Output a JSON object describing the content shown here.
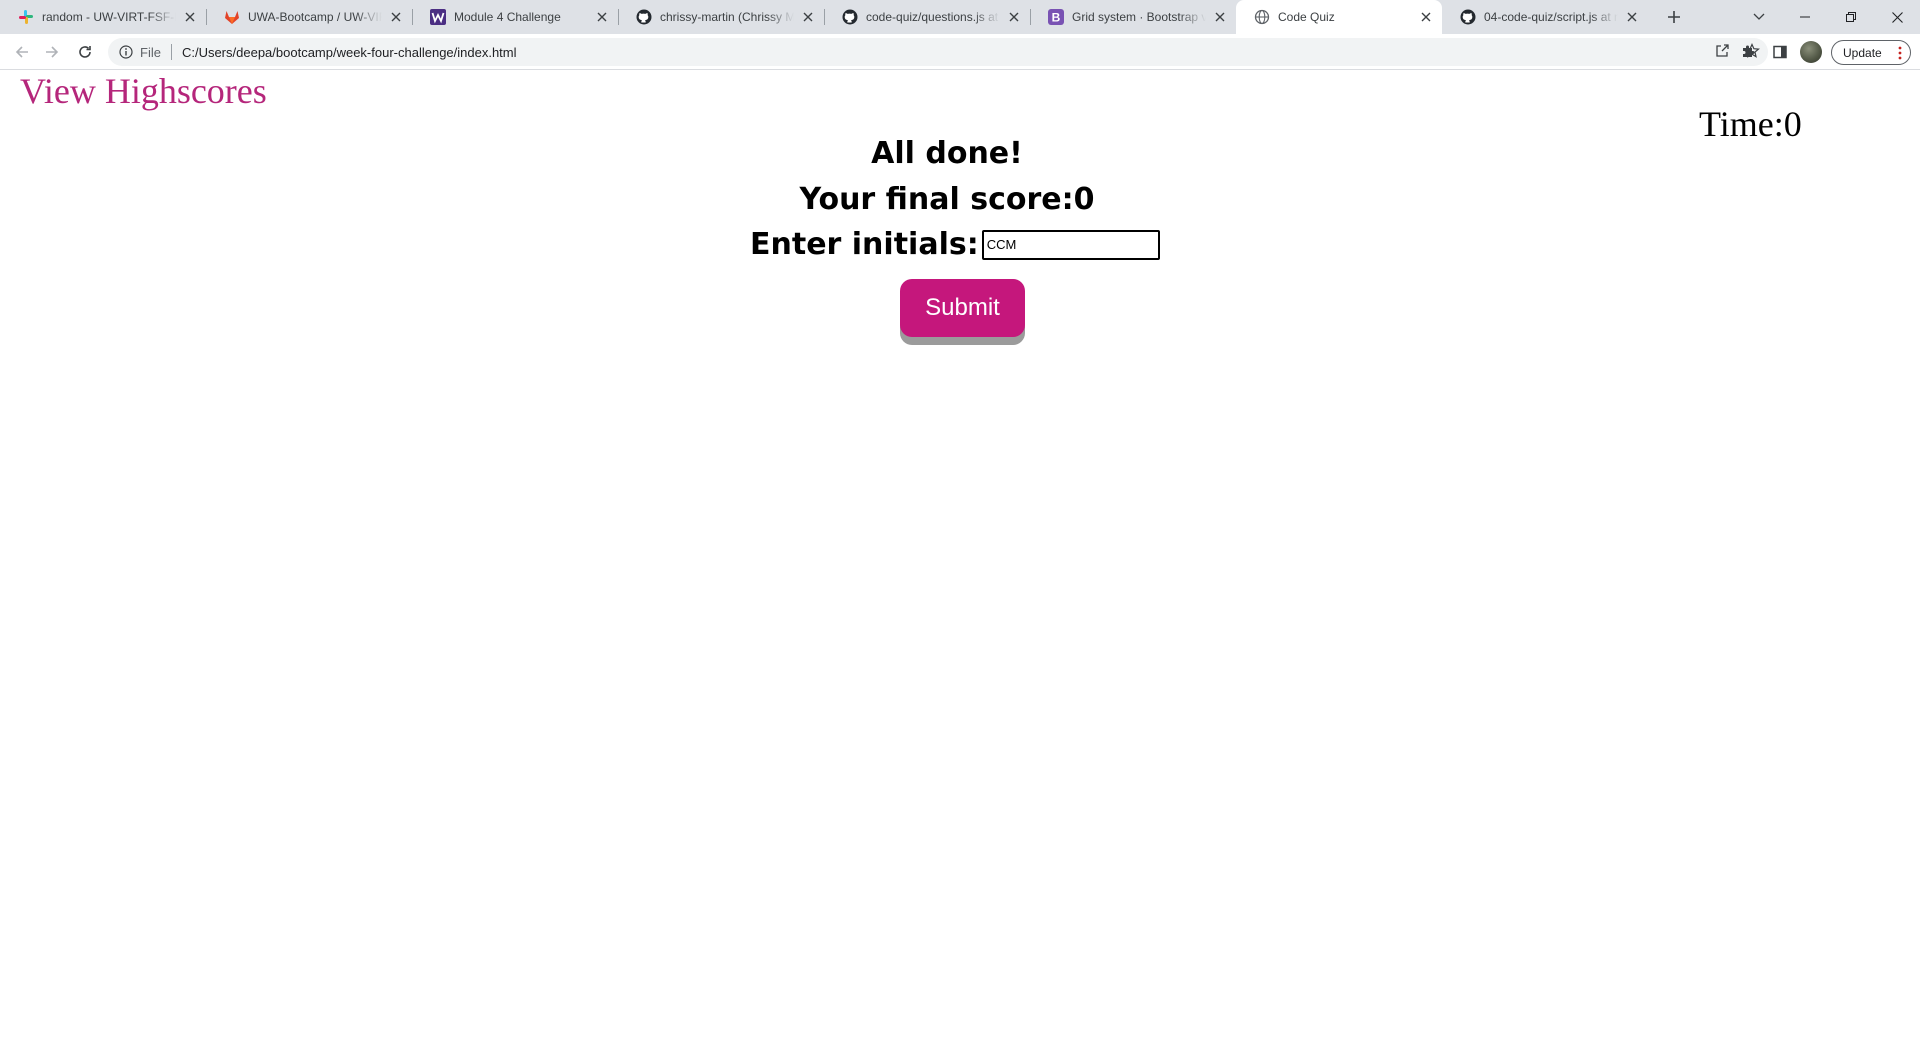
{
  "browser": {
    "tabs": [
      {
        "title": "random - UW-VIRT-FSF-PT",
        "icon": "slack-icon",
        "active": false
      },
      {
        "title": "UWA-Bootcamp / UW-VIRT",
        "icon": "gitlab-icon",
        "active": false
      },
      {
        "title": "Module 4 Challenge",
        "icon": "w-icon",
        "active": false
      },
      {
        "title": "chrissy-martin (Chrissy Martin)",
        "icon": "github-icon",
        "active": false
      },
      {
        "title": "code-quiz/questions.js at main",
        "icon": "github-icon",
        "active": false
      },
      {
        "title": "Grid system · Bootstrap v5",
        "icon": "bootstrap-icon",
        "active": false
      },
      {
        "title": "Code Quiz",
        "icon": "globe-icon",
        "active": true
      },
      {
        "title": "04-code-quiz/script.js at main",
        "icon": "github-icon",
        "active": false
      }
    ],
    "address": {
      "scheme": "File",
      "url": "C:/Users/deepa/bootcamp/week-four-challenge/index.html"
    },
    "update_label": "Update",
    "colors": {
      "tabstrip": "#dee1e6",
      "active_tab": "#ffffff",
      "omnibox": "#f1f3f4"
    }
  },
  "page": {
    "highscores_link": "View Highscores",
    "timer_label": "Time:",
    "timer_value": "0",
    "done_title": "All done!",
    "final_score_label": "Your final score:",
    "final_score_value": "0",
    "initials_label": "Enter initials:",
    "initials_value": "CCM",
    "submit_label": "Submit",
    "colors": {
      "link": "#b5267b",
      "submit_bg": "#c5177c",
      "submit_shadow": "#9b9b9b"
    }
  }
}
